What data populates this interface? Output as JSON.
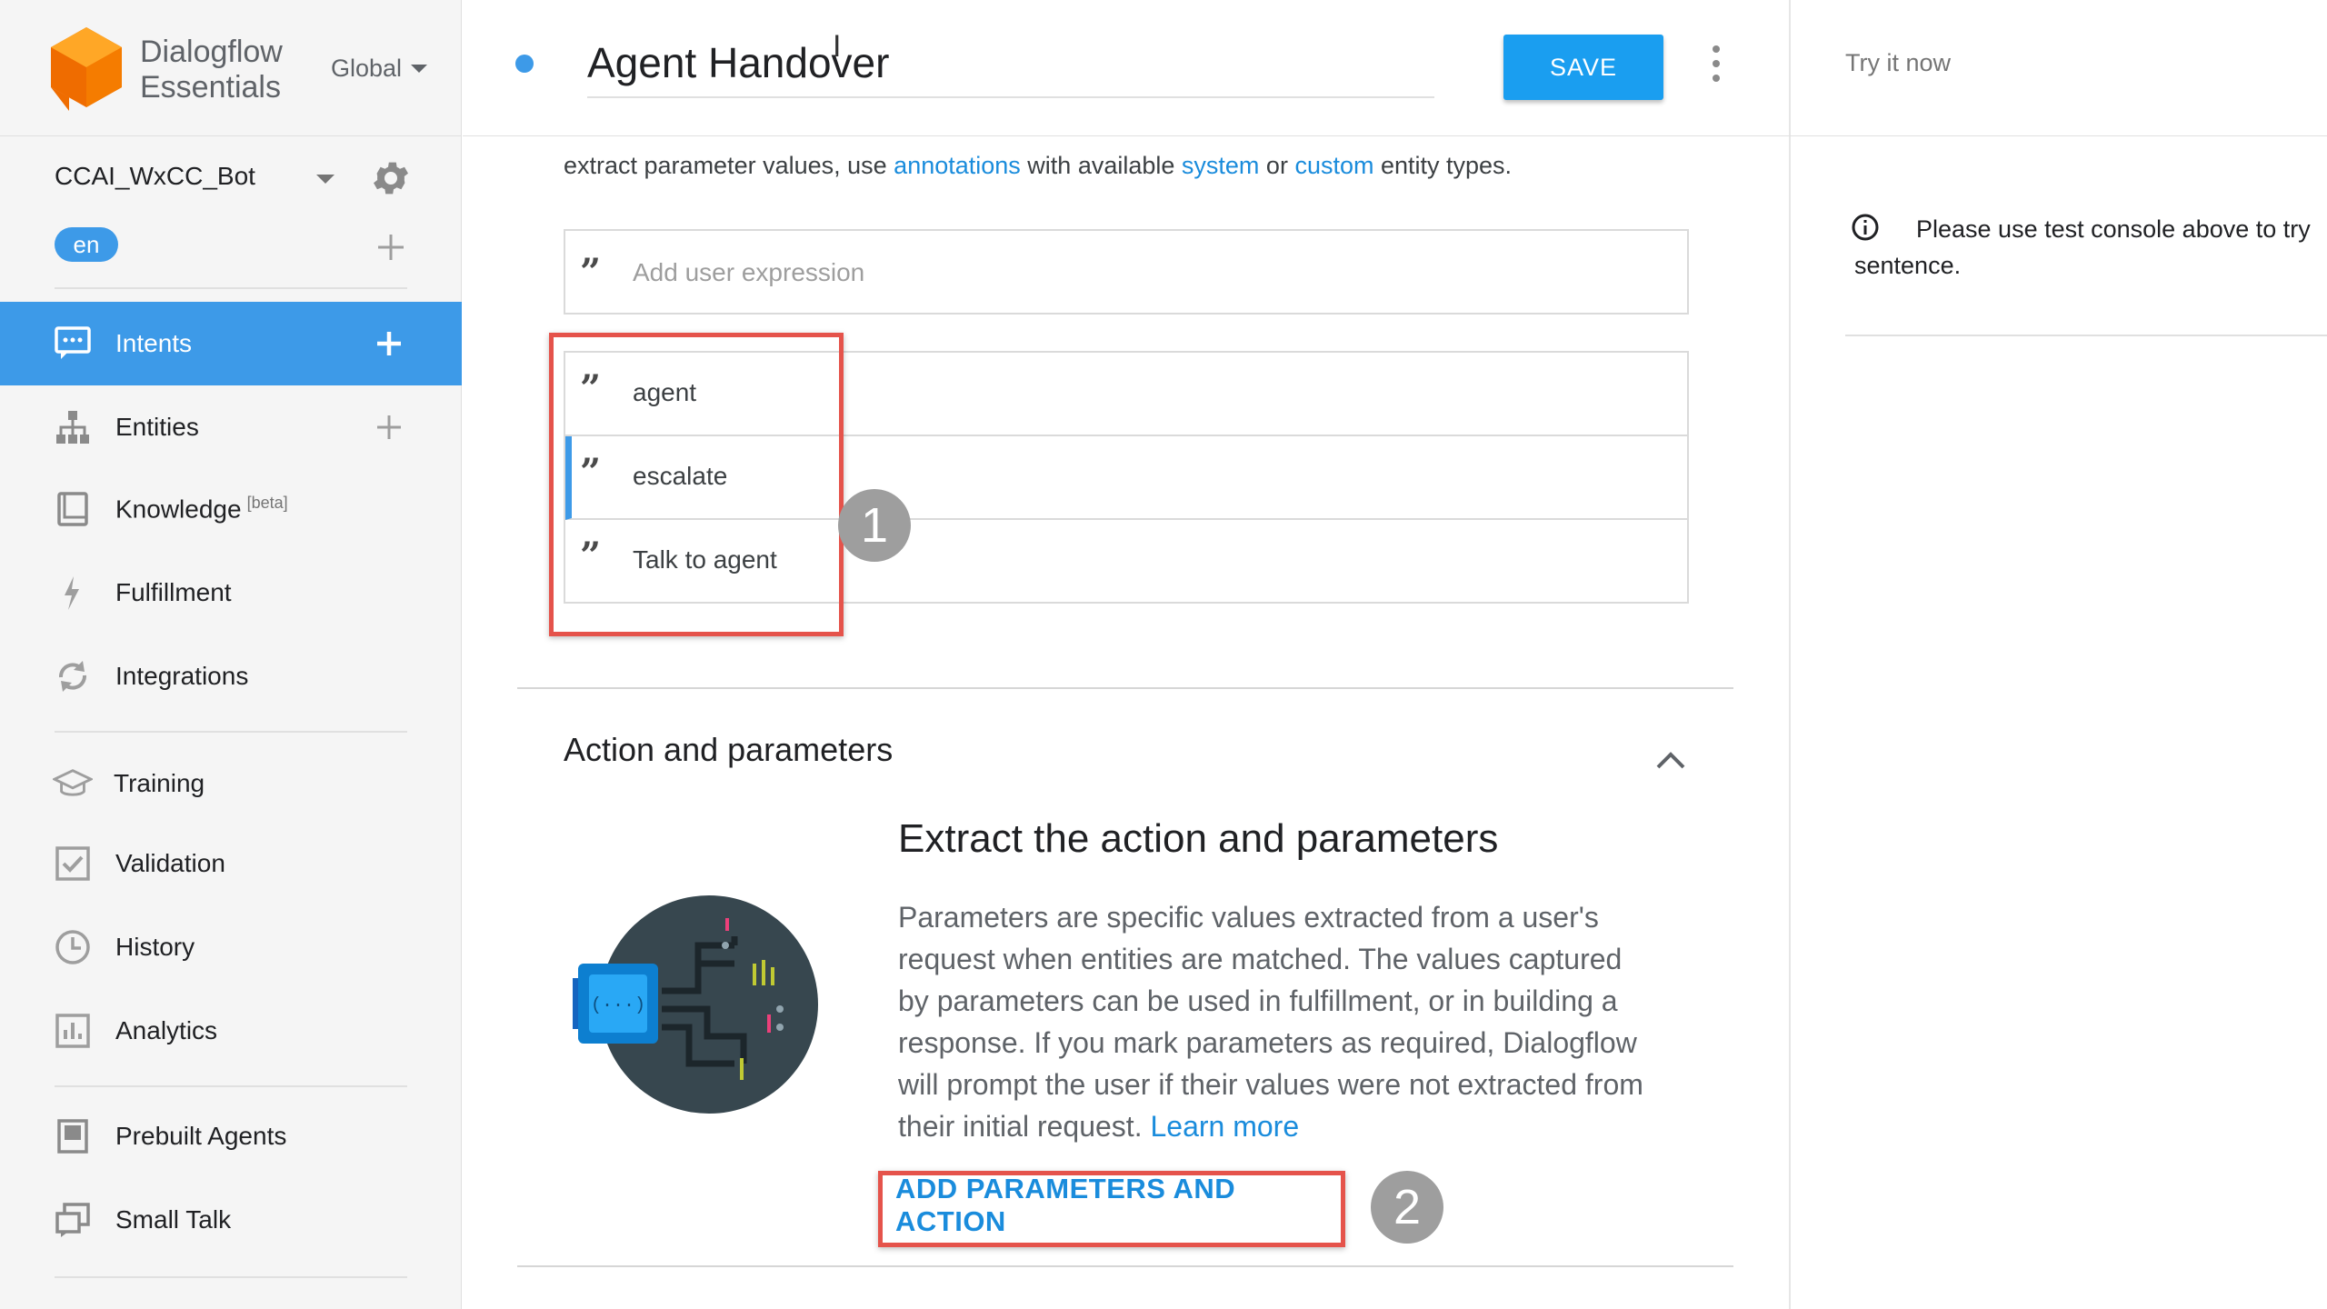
{
  "brand": {
    "line1": "Dialogflow",
    "line2": "Essentials"
  },
  "region": "Global",
  "agent": {
    "name": "CCAI_WxCC_Bot",
    "language": "en"
  },
  "nav": {
    "intents": "Intents",
    "entities": "Entities",
    "knowledge": "Knowledge",
    "knowledge_badge": "[beta]",
    "fulfillment": "Fulfillment",
    "integrations": "Integrations",
    "training": "Training",
    "validation": "Validation",
    "history": "History",
    "analytics": "Analytics",
    "prebuilt_agents": "Prebuilt Agents",
    "small_talk": "Small Talk"
  },
  "header": {
    "intent_title": "Agent Handover",
    "save_label": "SAVE"
  },
  "training_phrases": {
    "help_prefix": "extract parameter values, use ",
    "link_annotations": "annotations",
    "help_mid1": " with available ",
    "link_system": "system",
    "help_mid2": " or ",
    "link_custom": "custom",
    "help_suffix": " entity types.",
    "add_placeholder": "Add user expression",
    "expressions": [
      "agent",
      "escalate",
      "Talk to agent"
    ]
  },
  "callouts": {
    "one": "1",
    "two": "2"
  },
  "action_section": {
    "title": "Action and parameters",
    "extract_title": "Extract the action and parameters",
    "description": "Parameters are specific values extracted from a user's request when entities are matched. The values captured by parameters can be used in fulfillment, or in building a response. If you mark parameters as required, Dialogflow will prompt the user if their values were not extracted from their initial request. ",
    "learn_more": "Learn more",
    "add_button": "ADD PARAMETERS AND ACTION"
  },
  "test_console": {
    "placeholder": "Try it now",
    "info": "Please use test console above to try sentence."
  },
  "colors": {
    "accent": "#3d9ae8",
    "save_button": "#1a9ef0",
    "link": "#1a8cdc",
    "highlight": "#e5534b",
    "logo_orange": "#f57c00"
  }
}
